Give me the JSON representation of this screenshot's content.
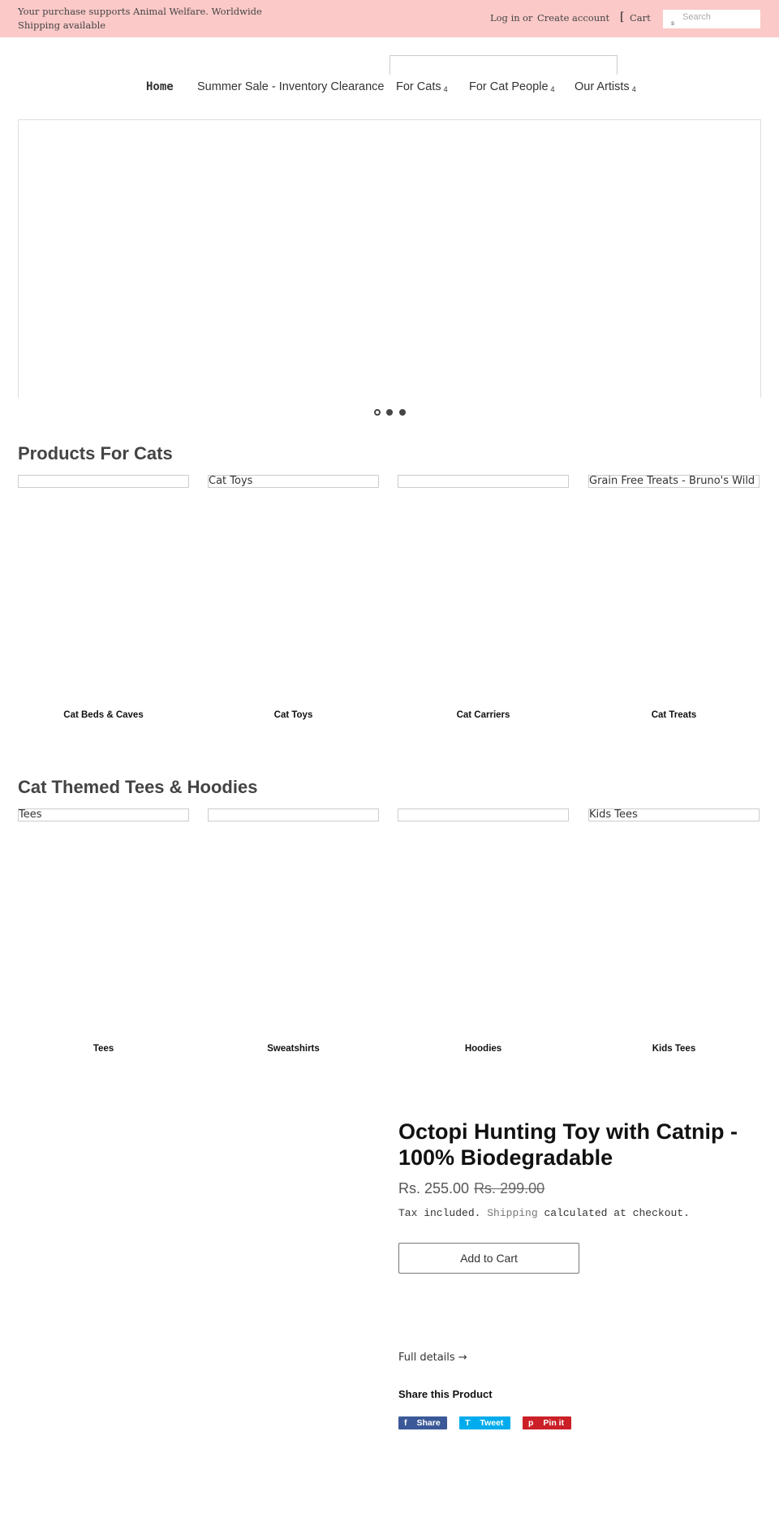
{
  "topbar": {
    "announcement": "Your purchase supports Animal Welfare. Worldwide Shipping available",
    "login": "Log in",
    "or": "or",
    "create_account": "Create account",
    "cart_icon": "[",
    "cart": "Cart",
    "search_placeholder": "Search",
    "search_icon": "s"
  },
  "nav": {
    "items": [
      {
        "label": "Home"
      },
      {
        "label": "Summer Sale - Inventory Clearance"
      },
      {
        "label": "For Cats",
        "badge": "4"
      },
      {
        "label": "For Cat People",
        "badge": "4"
      },
      {
        "label": "Our Artists",
        "badge": "4"
      }
    ]
  },
  "slideshow": {
    "slide_count": 3,
    "active_index": 0
  },
  "section1": {
    "title": "Products For Cats",
    "items": [
      {
        "alt": "",
        "label": "Cat Beds & Caves"
      },
      {
        "alt": "Cat Toys",
        "label": "Cat Toys"
      },
      {
        "alt": "",
        "label": "Cat Carriers"
      },
      {
        "alt": "Grain Free Treats - Bruno's Wild",
        "label": "Cat Treats"
      }
    ]
  },
  "section2": {
    "title": "Cat Themed Tees & Hoodies",
    "items": [
      {
        "alt": "Tees",
        "label": "Tees"
      },
      {
        "alt": "",
        "label": "Sweatshirts"
      },
      {
        "alt": "",
        "label": "Hoodies"
      },
      {
        "alt": "Kids Tees",
        "label": "Kids Tees"
      }
    ]
  },
  "product": {
    "title": "Octopi Hunting Toy with Catnip - 100% Biodegradable",
    "price": "Rs. 255.00",
    "compare_price": "Rs. 299.00",
    "tax_pre": "Tax included.",
    "tax_link": "Shipping",
    "tax_post": "calculated at checkout.",
    "add_to_cart": "Add to Cart",
    "full_details": "Full details →",
    "share_title": "Share this Product",
    "share": [
      {
        "icon": "f",
        "label": "Share",
        "color": "#3b5998"
      },
      {
        "icon": "T",
        "label": "Tweet",
        "color": "#00aced"
      },
      {
        "icon": "p",
        "label": "Pin it",
        "color": "#cb2027"
      }
    ]
  }
}
